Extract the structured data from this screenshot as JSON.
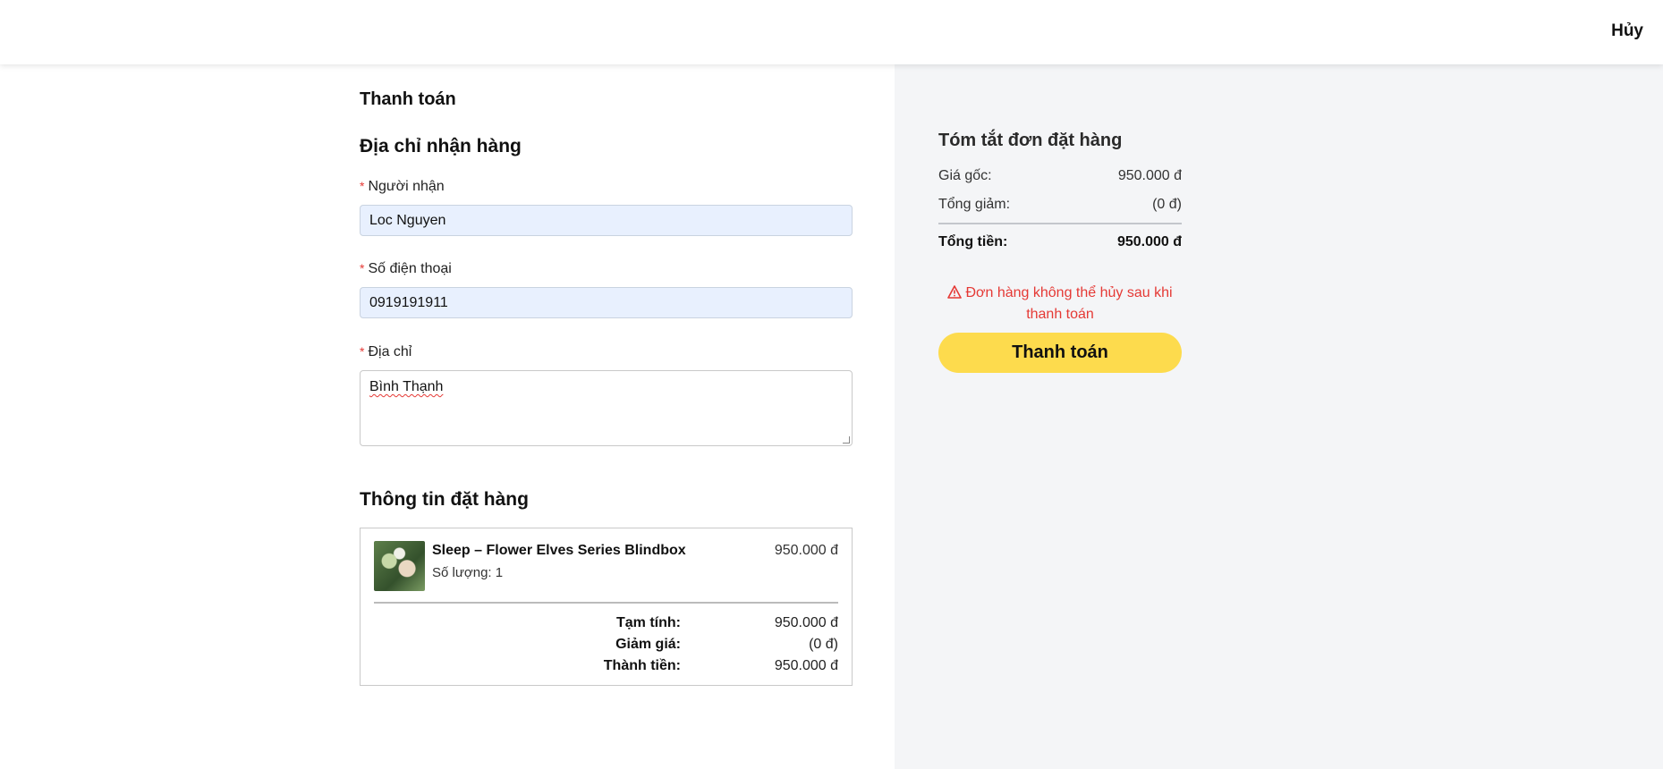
{
  "header": {
    "cancel_label": "Hủy"
  },
  "checkout": {
    "title": "Thanh toán",
    "address_section": {
      "title": "Địa chỉ nhận hàng",
      "required_mark": "*",
      "recipient_label": "Người nhận",
      "recipient_value": "Loc Nguyen",
      "phone_label": "Số điện thoại",
      "phone_value": "0919191911",
      "address_label": "Địa chỉ",
      "address_value": "Bình Thạnh"
    },
    "order_section": {
      "title": "Thông tin đặt hàng",
      "item": {
        "name": "Sleep – Flower Elves Series Blindbox",
        "quantity_text": "Số lượng: 1",
        "price": "950.000 đ",
        "thumbnail_icon": "product-thumbnail"
      },
      "subtotal_label": "Tạm tính:",
      "subtotal_value": "950.000 đ",
      "discount_label": "Giảm giá:",
      "discount_value": "(0 đ)",
      "total_label": "Thành tiền:",
      "total_value": "950.000 đ"
    }
  },
  "summary": {
    "title": "Tóm tắt đơn đặt hàng",
    "original_price_label": "Giá gốc:",
    "original_price_value": "950.000 đ",
    "total_discount_label": "Tổng giảm:",
    "total_discount_value": "(0 đ)",
    "total_label": "Tổng tiền:",
    "total_value": "950.000 đ",
    "warning_text": "Đơn hàng không thể hủy sau khi thanh toán",
    "warning_icon": "warning-triangle-icon",
    "pay_button_label": "Thanh toán"
  },
  "colors": {
    "accent_button": "#fddb4d",
    "warning": "#e53935",
    "required": "#e53935",
    "summary_bg": "#f4f5f7",
    "input_filled_bg": "#e8f0fe"
  }
}
